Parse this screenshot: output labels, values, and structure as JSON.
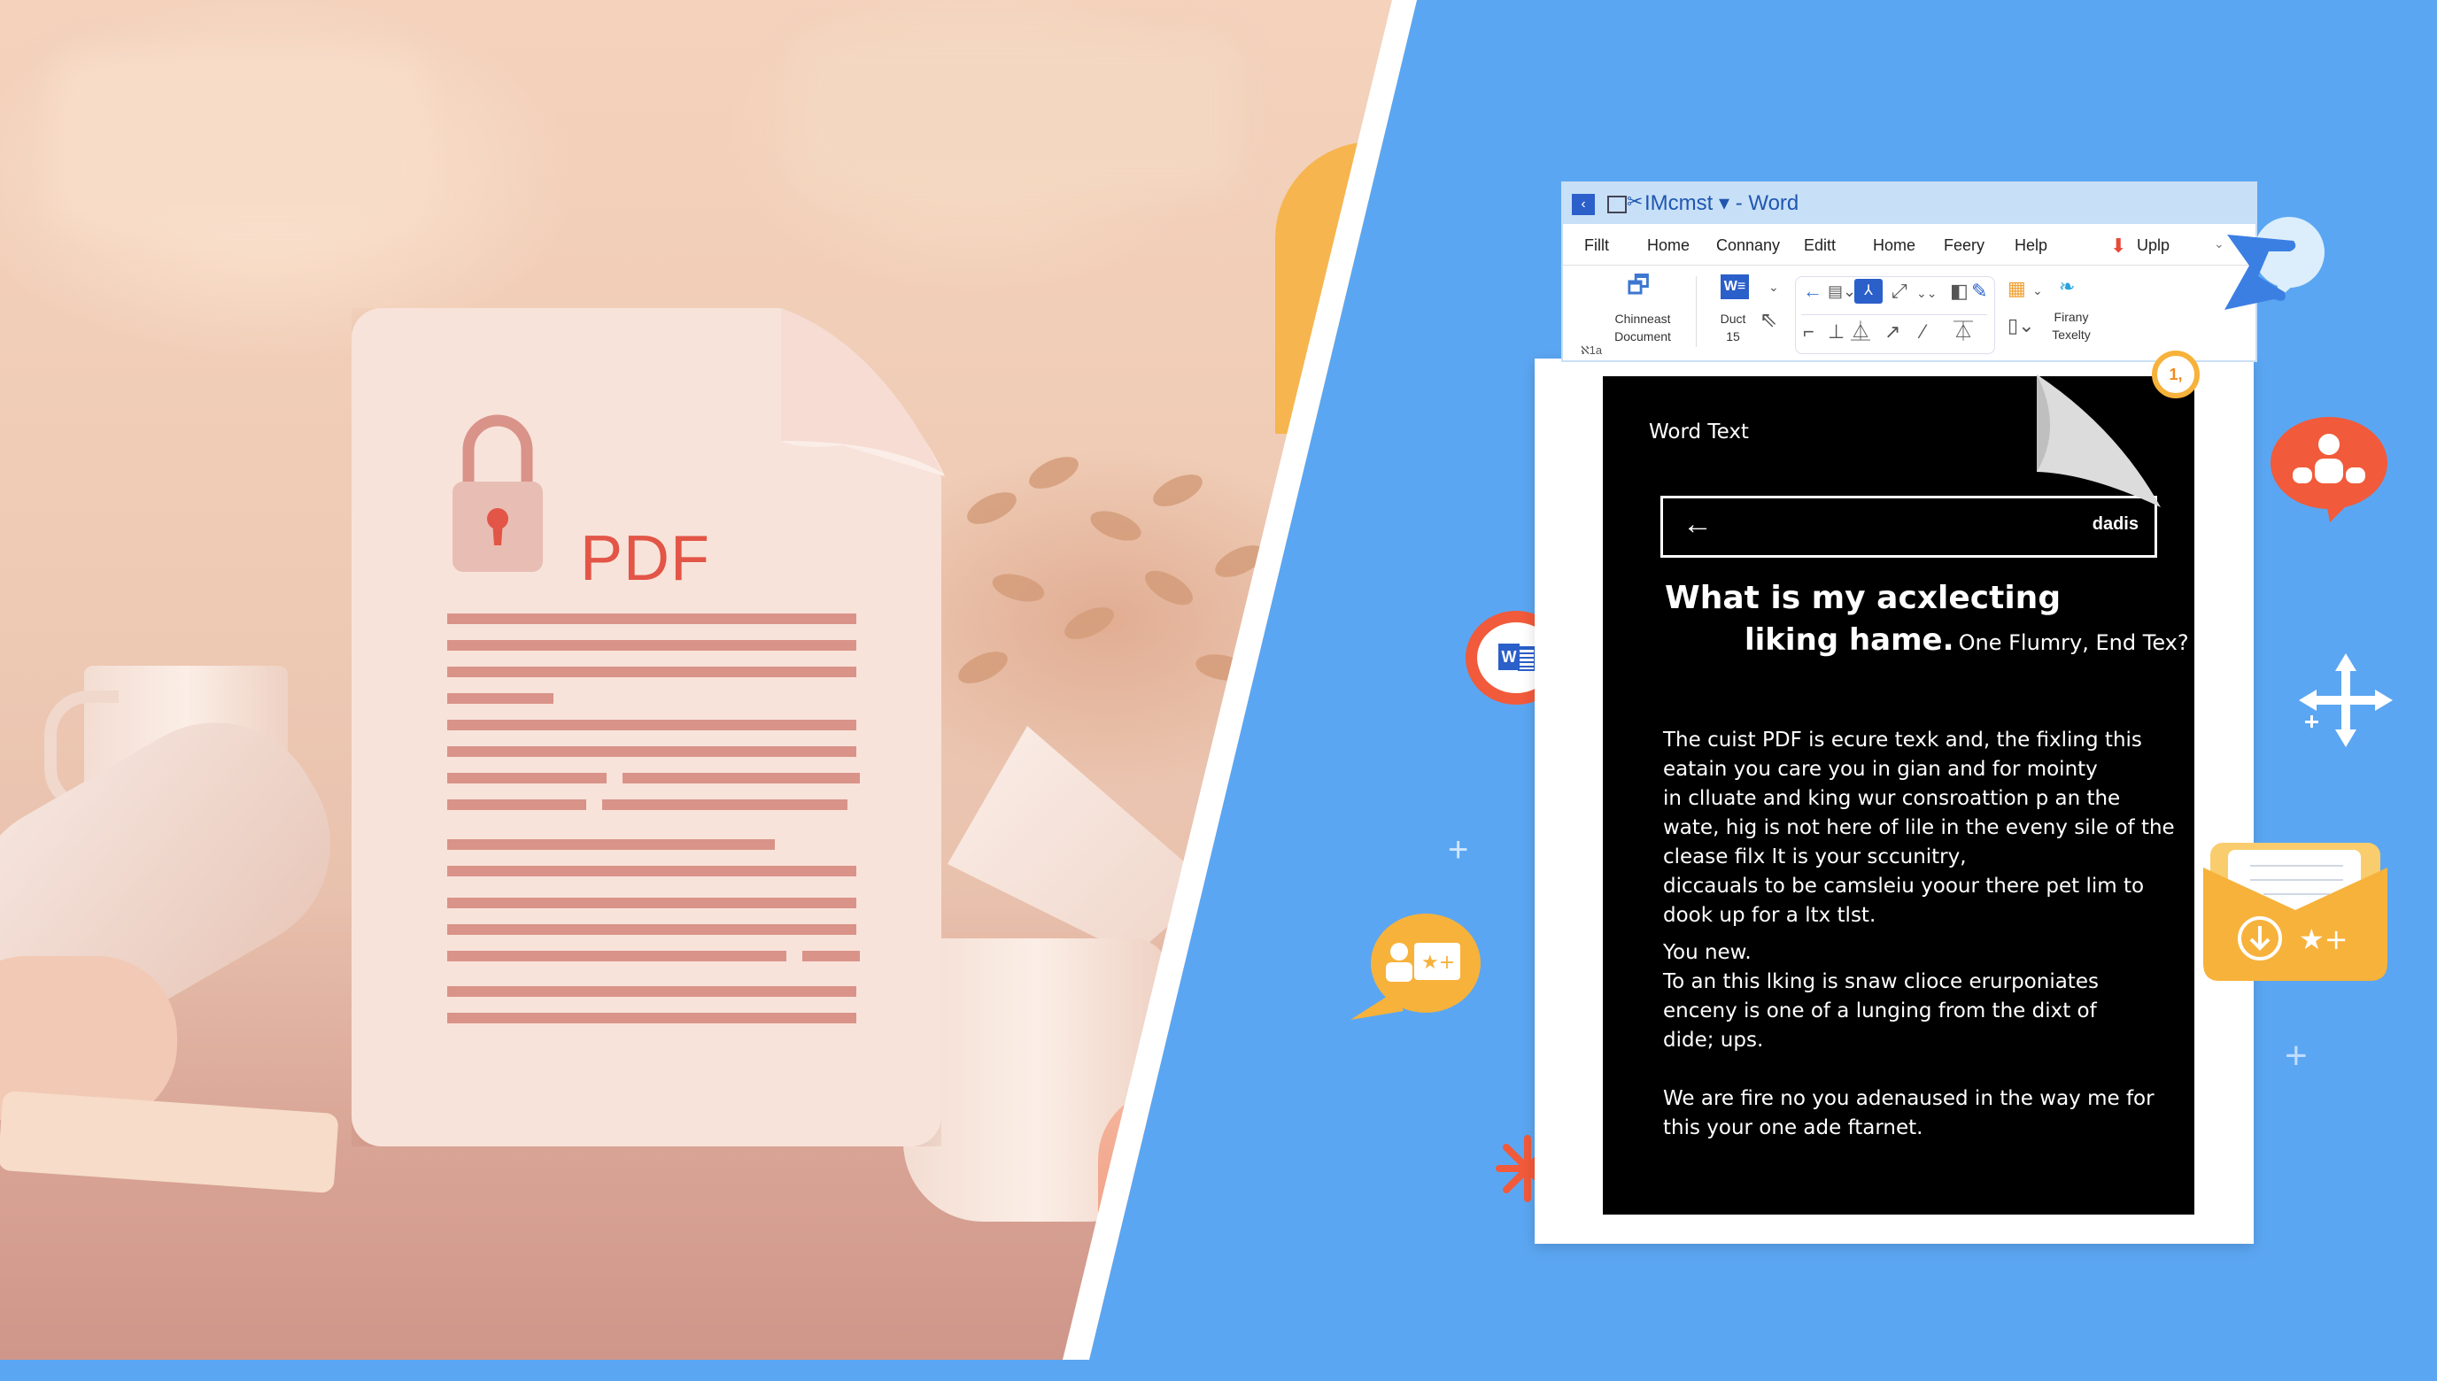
{
  "pdf_card": {
    "label": "PDF",
    "icon": "padlock-icon",
    "line_rows": [
      [
        1.0
      ],
      [
        1.0
      ],
      [
        1.0
      ],
      [
        0.26
      ],
      [
        1.0
      ],
      [
        1.0
      ],
      [
        0.39,
        0.58
      ],
      [
        0.34,
        0.6
      ],
      [
        0.8
      ],
      [
        1.0
      ],
      [
        1.0
      ],
      [
        1.0
      ],
      [
        0.83,
        0.14
      ],
      [
        1.0
      ],
      [
        1.0
      ]
    ]
  },
  "word_window": {
    "title": "IMcmst ▾ - Word",
    "title_icons": [
      "collapse-icon",
      "window-icon",
      "scissors-icon"
    ],
    "menu": [
      "Fillt",
      "Home",
      "Connany",
      "Editt",
      "Home",
      "Feery",
      "Help"
    ],
    "upload_label": "Uplp",
    "ribbon": {
      "group1_label_line1": "Chinneast",
      "group1_label_line2": "Document",
      "group2_label_line1": "Duct",
      "group2_label_line2": "15",
      "group4_label_line1": "Firany",
      "group4_label_line2": "Texelty",
      "corner_label": "ℵ1a"
    }
  },
  "document": {
    "header": "Word Text",
    "search_value": "dadis",
    "heading_line1": "What is my acxlecting",
    "heading_line2_bold": "liking hame.",
    "heading_line2_rest": "One Flumry, End Tex?",
    "paragraph1": [
      "The cuist PDF is ecure texk and, the fixling this",
      "eatain you care you in gian and for mointy",
      "in clluate and king wur consroattion p an the",
      "wate, hig is not here of lile in the eveny sile of the",
      "clease filx It is your sccunitry,",
      "diccauals to be camsleiu yoour there pet lim to",
      "dook up for a ltx tlst."
    ],
    "paragraph2": [
      "You new.",
      "To an this lking is snaw clioce erurponiates",
      "enceny is one of a lunging from the dixt of",
      "dide; ups."
    ],
    "paragraph3": [
      "We are fire no you adenaused in the way me for",
      "this  your one ade ftarnet."
    ]
  },
  "badges": {
    "orange_ring_badge": "1,"
  },
  "floating_icons": [
    "word-badge-icon",
    "chat-profile-icon",
    "group-chat-icon",
    "move-arrows-icon",
    "envelope-download-icon",
    "paper-plane-icon",
    "asterisk-icon",
    "plus-icon"
  ],
  "colors": {
    "right_bg": "#5ba6f2",
    "pdf_red": "#e25547",
    "word_blue": "#2b5fc9",
    "orange": "#f7b23b",
    "coral": "#f15a3a"
  }
}
